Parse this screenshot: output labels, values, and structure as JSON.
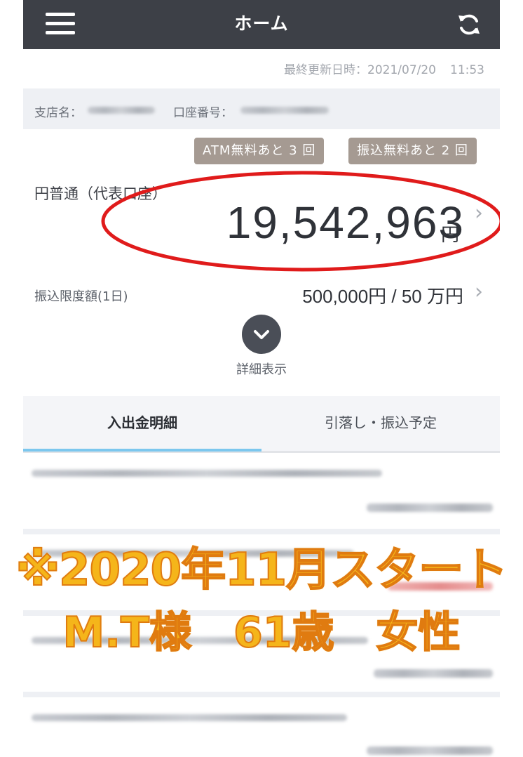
{
  "header": {
    "title": "ホーム",
    "menu_icon": "hamburger-menu-icon",
    "refresh_icon": "refresh-icon"
  },
  "last_updated": {
    "label": "最終更新日時：",
    "date": "2021/07/20",
    "time": "11:53"
  },
  "account_info": {
    "branch_label": "支店名：",
    "account_number_label": "口座番号："
  },
  "badges": {
    "atm": "ATM無料あと 3 回",
    "transfer": "振込無料あと 2 回"
  },
  "balance": {
    "account_name": "円普通（代表口座）",
    "amount": "19,542,963",
    "unit": "円",
    "highlight_color": "#e01b1b"
  },
  "transfer_limit": {
    "label": "振込限度額(1日)",
    "value": "500,000円 / 50 万円"
  },
  "details": {
    "label": "詳細表示"
  },
  "tabs": [
    {
      "label": "入出金明細",
      "active": true
    },
    {
      "label": "引落し・振込予定",
      "active": false
    }
  ],
  "overlay": {
    "line1": "※2020年11月スタート",
    "line2": "M.T様　61歳　女性",
    "color": "#f5b51a"
  }
}
